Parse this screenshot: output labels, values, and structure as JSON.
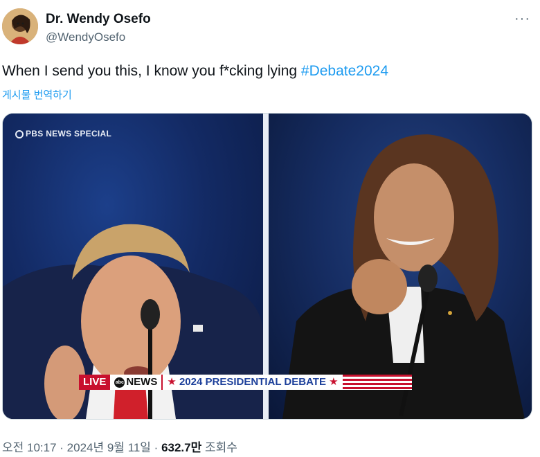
{
  "author": {
    "name": "Dr. Wendy Osefo",
    "handle": "@WendyOsefo"
  },
  "more_label": "···",
  "tweet": {
    "text": "When I send you this, I know you f*cking lying ",
    "hashtag": "#Debate2024",
    "translate_label": "게시물 번역하기"
  },
  "media": {
    "watermark": "PBS NEWS SPECIAL",
    "lower_third": {
      "live": "LIVE",
      "network": "NEWS",
      "network_logo": "abc",
      "title": "2024 PRESIDENTIAL DEBATE",
      "star": "★"
    }
  },
  "meta": {
    "time": "오전 10:17",
    "separator": " · ",
    "date": "2024년 9월 11일",
    "views_count": "632.7만",
    "views_label": " 조회수"
  },
  "colors": {
    "accent": "#1d9bf0",
    "text": "#0f1419",
    "muted": "#536471",
    "live_red": "#c8102e",
    "debate_blue": "#1c3f9a"
  }
}
